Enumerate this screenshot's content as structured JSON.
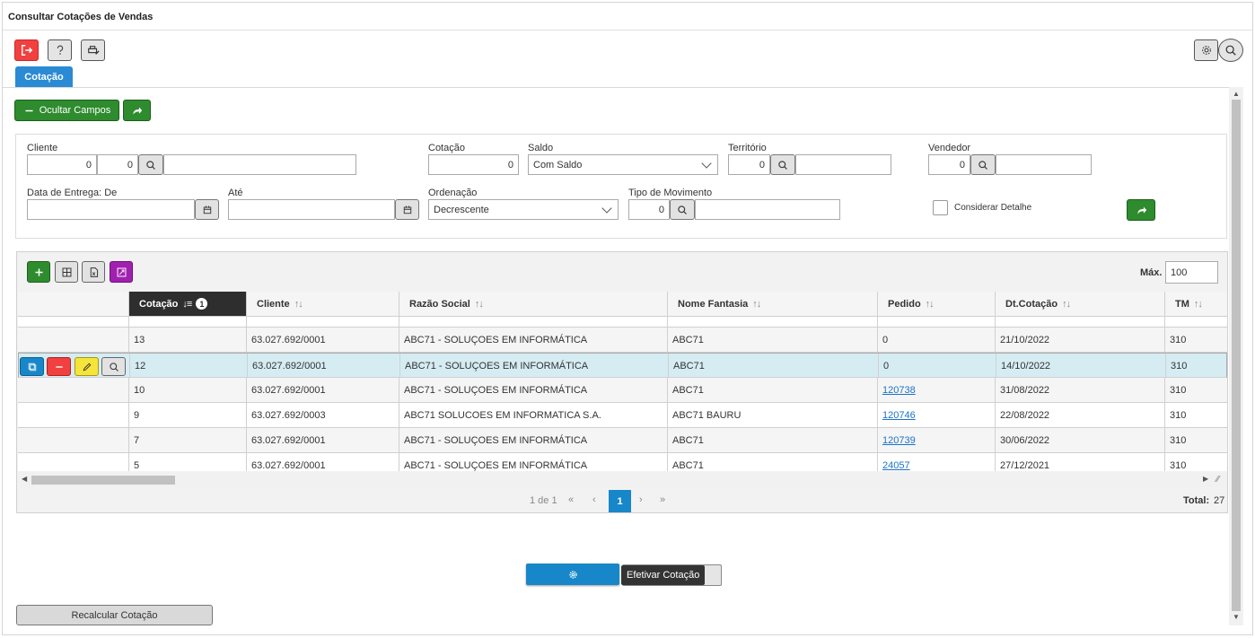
{
  "window": {
    "title": "Consultar Cotações de Vendas"
  },
  "tabs": [
    {
      "label": "Cotação"
    }
  ],
  "toolbar": {
    "hide_fields_label": "Ocultar Campos"
  },
  "filters": {
    "cliente": {
      "label": "Cliente",
      "code1": "0",
      "code2": "0",
      "name": ""
    },
    "cotacao": {
      "label": "Cotação",
      "value": "0"
    },
    "saldo": {
      "label": "Saldo",
      "value": "Com Saldo"
    },
    "territorio": {
      "label": "Território",
      "code": "0",
      "name": ""
    },
    "vendedor": {
      "label": "Vendedor",
      "code": "0",
      "name": ""
    },
    "data_entrega_de": {
      "label": "Data de Entrega: De",
      "value": ""
    },
    "ate": {
      "label": "Até",
      "value": ""
    },
    "ordenacao": {
      "label": "Ordenação",
      "value": "Decrescente"
    },
    "tipo_movimento": {
      "label": "Tipo de Movimento",
      "code": "0",
      "name": ""
    },
    "considerar_detalhe": {
      "label": "Considerar Detalhe",
      "checked": false
    }
  },
  "grid": {
    "max_label": "Máx.",
    "max_value": "100",
    "columns": [
      {
        "label": "Cotação",
        "sort_badge": "1"
      },
      {
        "label": "Cliente"
      },
      {
        "label": "Razão Social"
      },
      {
        "label": "Nome Fantasia"
      },
      {
        "label": "Pedido"
      },
      {
        "label": "Dt.Cotação"
      },
      {
        "label": "TM"
      }
    ],
    "rows": [
      {
        "cotacao": "13",
        "cliente": "63.027.692/0001",
        "razao": "ABC71 - SOLUÇOES EM INFORMÁTICA",
        "fantasia": "ABC71",
        "pedido": "0",
        "pedido_link": false,
        "data": "21/10/2022",
        "tm": "310"
      },
      {
        "cotacao": "12",
        "cliente": "63.027.692/0001",
        "razao": "ABC71 - SOLUÇOES EM INFORMÁTICA",
        "fantasia": "ABC71",
        "pedido": "0",
        "pedido_link": false,
        "data": "14/10/2022",
        "tm": "310"
      },
      {
        "cotacao": "10",
        "cliente": "63.027.692/0001",
        "razao": "ABC71 - SOLUÇOES EM INFORMÁTICA",
        "fantasia": "ABC71",
        "pedido": "120738",
        "pedido_link": true,
        "data": "31/08/2022",
        "tm": "310"
      },
      {
        "cotacao": "9",
        "cliente": "63.027.692/0003",
        "razao": "ABC71 SOLUCOES EM INFORMATICA S.A.",
        "fantasia": "ABC71 BAURU",
        "pedido": "120746",
        "pedido_link": true,
        "data": "22/08/2022",
        "tm": "310"
      },
      {
        "cotacao": "7",
        "cliente": "63.027.692/0001",
        "razao": "ABC71 - SOLUÇOES EM INFORMÁTICA",
        "fantasia": "ABC71",
        "pedido": "120739",
        "pedido_link": true,
        "data": "30/06/2022",
        "tm": "310"
      },
      {
        "cotacao": "5",
        "cliente": "63.027.692/0001",
        "razao": "ABC71 - SOLUÇOES EM INFORMÁTICA",
        "fantasia": "ABC71",
        "pedido": "24057",
        "pedido_link": true,
        "data": "27/12/2021",
        "tm": "310"
      }
    ],
    "pager": {
      "page_info": "1 de 1",
      "current_page": "1",
      "total_label": "Total:",
      "total_value": "27"
    }
  },
  "actions": {
    "efetivar_tooltip": "Efetivar Cotação",
    "recalcular_label": "Recalcular Cotação"
  },
  "colors": {
    "accent": "#1887c9",
    "green": "#2e8b2e",
    "red": "#f04040",
    "yellow": "#f5e43a",
    "purple": "#a020b0"
  }
}
